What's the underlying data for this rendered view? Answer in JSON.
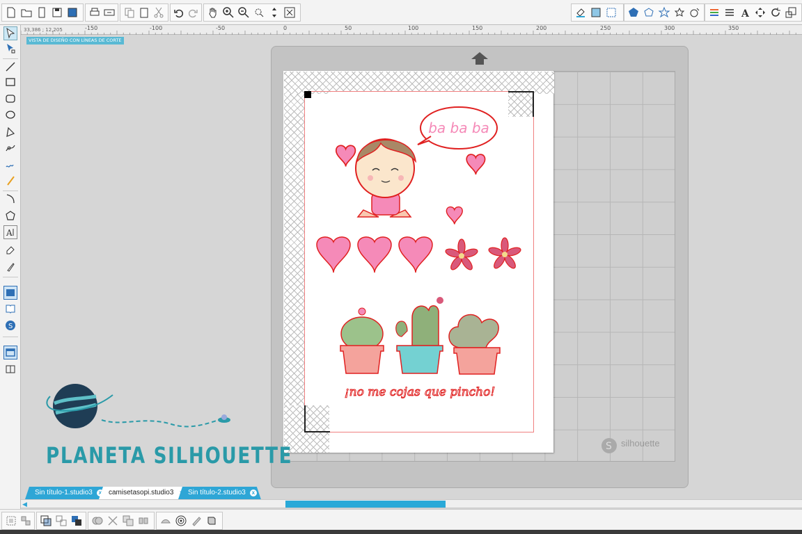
{
  "ruler": {
    "coords": "33,386 ; 12,205",
    "labels": [
      "-150",
      "-100",
      "-50",
      "0",
      "50",
      "100",
      "150",
      "200",
      "250",
      "300",
      "350"
    ]
  },
  "view_label": "VISTA DE DISEÑO CON LÍNEAS DE CORTE",
  "mat": {
    "brand": "silhouette"
  },
  "artwork": {
    "speech_bubble": "ba ba ba",
    "cactus_slogan": "¡no me cojas que pincho!"
  },
  "tabs": [
    {
      "label": "Sin título-1.studio3",
      "close": "x",
      "active": false
    },
    {
      "label": "camisetasopi.studio3",
      "close": "x",
      "active": true
    },
    {
      "label": "Sin título-2.studio3",
      "close": "x",
      "active": false
    }
  ],
  "watermark": {
    "text": "PLANETA SILHOUETTE"
  },
  "colors": {
    "accent": "#2ea6d6",
    "cut_line": "#e02020",
    "pink": "#f58ab8",
    "mat": "#c3c3c3"
  }
}
